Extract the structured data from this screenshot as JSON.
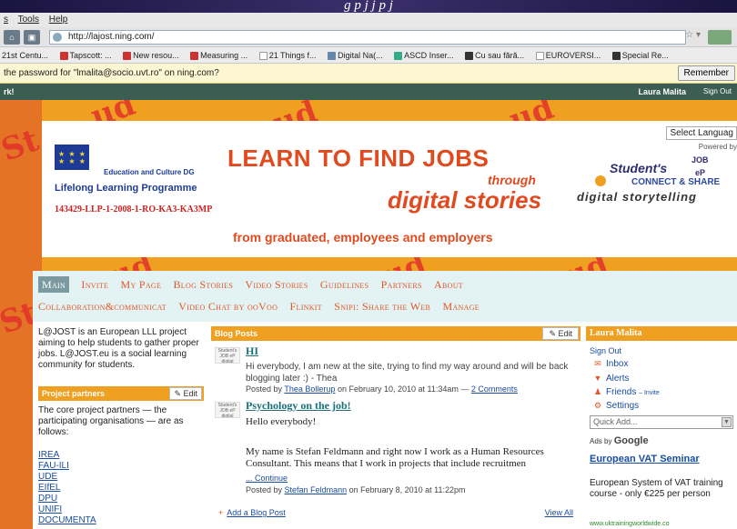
{
  "caption": "g                                 p   j     j  p   j",
  "browser": {
    "menu": [
      "s",
      "Tools",
      "Help"
    ],
    "url": "http://lajost.ning.com/",
    "bookmarks": [
      "21st Centu...",
      "Tapscott: ...",
      "New resou...",
      "Measuring ...",
      "21 Things f...",
      "Digital Na(...",
      "ASCD Inser...",
      "Cu sau fără...",
      "EUROVERSI...",
      "Special Re..."
    ],
    "password_prompt": "the password for \"lmalita@socio.uvt.ro\" on ning.com?",
    "remember_button": "Remember"
  },
  "ningbar": {
    "left": "rk!",
    "user": "Laura Malita",
    "signout": "Sign Out"
  },
  "banner": {
    "edu_dg": "Education and Culture DG",
    "llp": "Lifelong Learning Programme",
    "project_code": "143429-LLP-1-2008-1-RO-KA3-KA3MP",
    "headline": "LEARN TO FIND JOBS",
    "through": "through",
    "digital": "digital stories",
    "tagline": "from graduated, employees and employers",
    "select_language": "Select Languag",
    "powered_by": "Powered by",
    "students_logo": {
      "name": "Student's",
      "job": "JOB",
      "ep": "eP",
      "connect": "CONNECT & SHARE",
      "digital": "digital storytelling"
    }
  },
  "nav": {
    "row1": [
      "Main",
      "Invite",
      "My Page",
      "Blog Stories",
      "Video Stories",
      "Guidelines",
      "Partners",
      "About"
    ],
    "row2": [
      "Collaboration&communicat",
      "Video Chat by ooVoo",
      "Flinkit",
      "Snipi: Share the Web",
      "Manage"
    ]
  },
  "left": {
    "intro": "L@JOST is an European LLL project aiming to help students to gather proper jobs. L@JOST.eu is a social learning community for students.",
    "pp_title": "Project partners",
    "pp_edit": "Edit",
    "pp_text": "The core project partners — the participating organisations — are as follows:",
    "partners": [
      "IREA",
      "FAU-ILI",
      "UDE",
      "EIfEL",
      "DPU",
      "UNIFI",
      "DOCUMENTA"
    ]
  },
  "blog": {
    "title": "Blog Posts",
    "edit": "Edit",
    "thumb_text": "Student's JOB eP digital storytelling",
    "posts": [
      {
        "title": "HI",
        "body": "Hi everybody, I am new at the site, trying to find my way around and will be back blogging later :) - Thea",
        "meta_prefix": "Posted by",
        "author": "Thea Bollerup",
        "meta_date": "on February 10, 2010 at 11:34am —",
        "comments": "2 Comments"
      },
      {
        "title": "Psychology on the job!",
        "greeting": "Hello everybody!",
        "body": "My name is Stefan Feldmann and right now I work as a Human Resources Consultant. This means that I work in projects that include recruitmen",
        "continue": "... Continue",
        "meta_prefix": "Posted by",
        "author": "Stefan Feldmann",
        "meta_date": "on February 8, 2010 at 11:22pm"
      }
    ],
    "add_post": "Add a Blog Post",
    "view_all": "View All"
  },
  "right": {
    "user": "Laura Malita",
    "signout": "Sign Out",
    "inbox": "Inbox",
    "alerts": "Alerts",
    "friends": "Friends",
    "invite": "– Invite",
    "settings": "Settings",
    "quick_add": "Quick Add...",
    "ads_by": "Ads by",
    "google": "Google",
    "ad_title": "European VAT Seminar",
    "ad_text": "European System of VAT training course - only €225 per person",
    "ad_url": "www.uktrainingworldwide.co"
  }
}
